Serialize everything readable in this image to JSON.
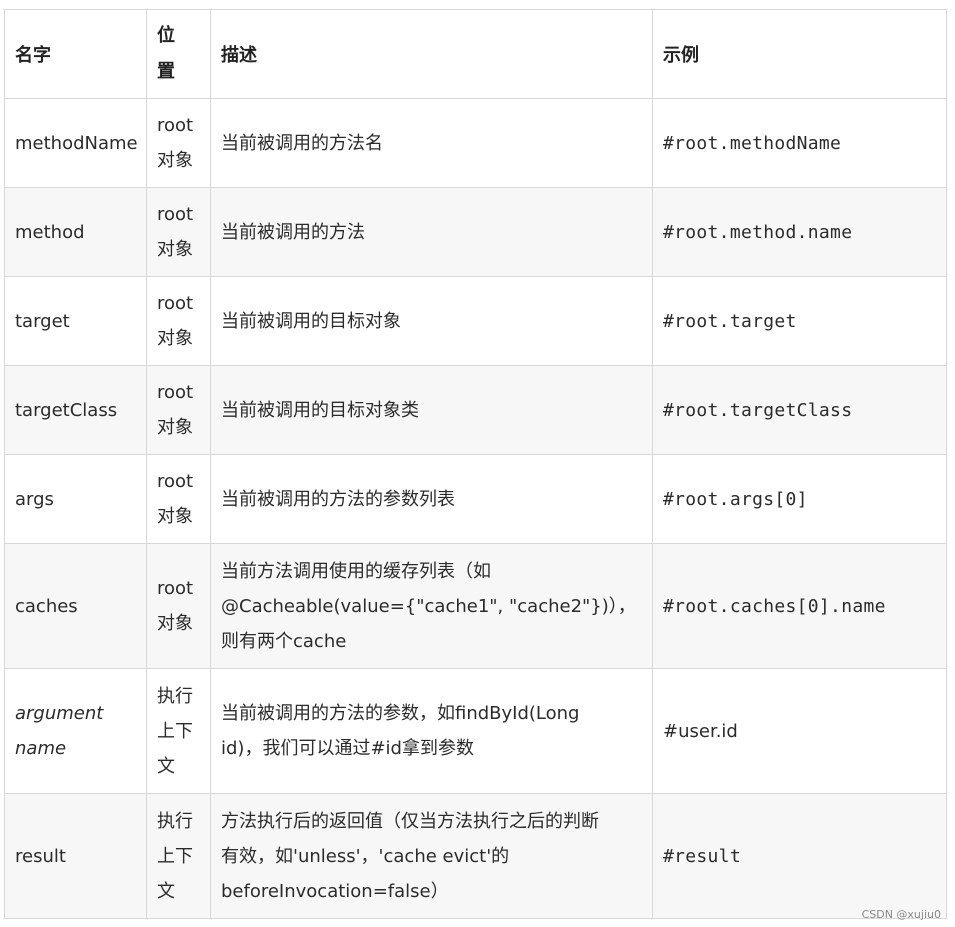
{
  "table": {
    "headers": {
      "name": "名字",
      "position_line1": "位",
      "position_line2": "置",
      "description": "描述",
      "example": "示例"
    },
    "rows": [
      {
        "name": "methodName",
        "position": [
          "root",
          "对象"
        ],
        "description": [
          "当前被调用的方法名"
        ],
        "example": "#root.methodName"
      },
      {
        "name": "method",
        "position": [
          "root",
          "对象"
        ],
        "description": [
          "当前被调用的方法"
        ],
        "example": "#root.method.name"
      },
      {
        "name": "target",
        "position": [
          "root",
          "对象"
        ],
        "description": [
          "当前被调用的目标对象"
        ],
        "example": "#root.target"
      },
      {
        "name": "targetClass",
        "position": [
          "root",
          "对象"
        ],
        "description": [
          "当前被调用的目标对象类"
        ],
        "example": "#root.targetClass"
      },
      {
        "name": "args",
        "position": [
          "root",
          "对象"
        ],
        "description": [
          "当前被调用的方法的参数列表"
        ],
        "example": "#root.args[0]"
      },
      {
        "name": "caches",
        "position": [
          "root",
          "对象"
        ],
        "description": [
          "当前方法调用使用的缓存列表（如",
          "@Cacheable(value={\"cache1\", \"cache2\"})），",
          "则有两个cache"
        ],
        "example": "#root.caches[0].name"
      },
      {
        "name_line1": "argument",
        "name_line2": "name",
        "position": [
          "执行",
          "上下",
          "文"
        ],
        "description": [
          "当前被调用的方法的参数，如findById(Long",
          "id)，我们可以通过#id拿到参数"
        ],
        "example": "#user.id"
      },
      {
        "name": "result",
        "position": [
          "执行",
          "上下",
          "文"
        ],
        "description": [
          "方法执行后的返回值（仅当方法执行之后的判断",
          "有效，如'unless'，'cache evict'的",
          "beforeInvocation=false）"
        ],
        "example": "#result"
      }
    ]
  },
  "watermark": "CSDN @xujiu0"
}
